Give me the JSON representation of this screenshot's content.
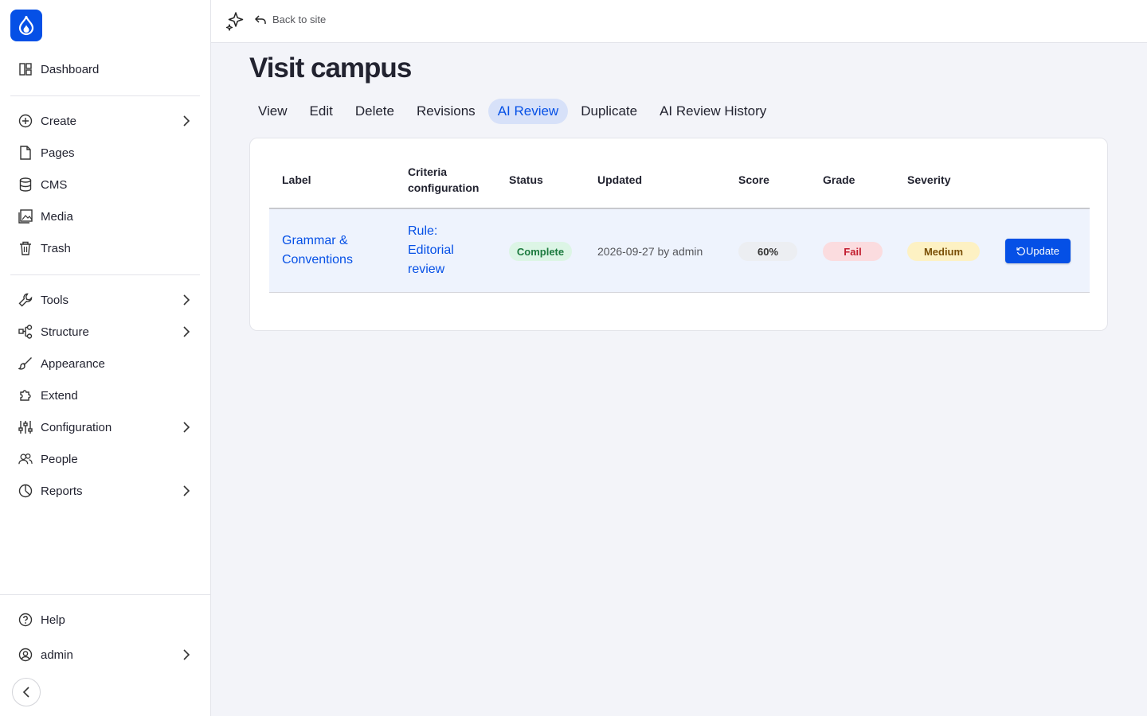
{
  "sidebar": {
    "items": [
      {
        "label": "Dashboard",
        "icon": "dashboard-icon"
      },
      {
        "label": "Create",
        "icon": "plus-circle-icon",
        "has_children": true
      },
      {
        "label": "Pages",
        "icon": "file-icon"
      },
      {
        "label": "CMS",
        "icon": "database-icon"
      },
      {
        "label": "Media",
        "icon": "image-icon"
      },
      {
        "label": "Trash",
        "icon": "trash-icon"
      },
      {
        "label": "Tools",
        "icon": "wrench-icon",
        "has_children": true
      },
      {
        "label": "Structure",
        "icon": "structure-icon",
        "has_children": true
      },
      {
        "label": "Appearance",
        "icon": "brush-icon"
      },
      {
        "label": "Extend",
        "icon": "puzzle-icon"
      },
      {
        "label": "Configuration",
        "icon": "sliders-icon",
        "has_children": true
      },
      {
        "label": "People",
        "icon": "people-icon"
      },
      {
        "label": "Reports",
        "icon": "chart-pie-icon",
        "has_children": true
      }
    ],
    "help_label": "Help",
    "user_label": "admin"
  },
  "topbar": {
    "back_label": "Back to site"
  },
  "page": {
    "title": "Visit campus",
    "tabs": [
      {
        "label": "View"
      },
      {
        "label": "Edit"
      },
      {
        "label": "Delete"
      },
      {
        "label": "Revisions"
      },
      {
        "label": "AI Review",
        "active": true
      },
      {
        "label": "Duplicate"
      },
      {
        "label": "AI Review History"
      }
    ]
  },
  "table": {
    "headers": {
      "label": "Label",
      "criteria_line1": "Criteria",
      "criteria_line2": "configuration",
      "status": "Status",
      "updated": "Updated",
      "score": "Score",
      "grade": "Grade",
      "severity": "Severity"
    },
    "row": {
      "label_line1": "Grammar &",
      "label_line2": "Conventions",
      "criteria_line1": "Rule:",
      "criteria_line2": "Editorial",
      "criteria_line3": "review",
      "status": "Complete",
      "updated": "2026-09-27 by admin",
      "score": "60%",
      "grade": "Fail",
      "severity": "Medium",
      "action_label": "Update"
    }
  },
  "colors": {
    "accent": "#0550e6",
    "complete_bg": "#dcf5e5",
    "complete_fg": "#1c7a3e",
    "fail_bg": "#fbdcdf",
    "fail_fg": "#c21d2f",
    "medium_bg": "#fdf1c3",
    "medium_fg": "#7a4f06",
    "score_bg": "#eceef2"
  }
}
